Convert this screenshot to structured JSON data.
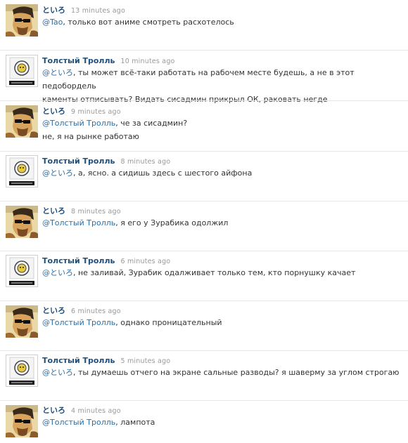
{
  "users": {
    "toiro": {
      "name": "といろ",
      "avatar": "sunglasses-man-avatar"
    },
    "troll": {
      "name": "Толстый Тролль",
      "avatar": "troll-badge-avatar"
    }
  },
  "tweets": [
    {
      "author": "といろ",
      "time": "13 minutes ago",
      "lines": [
        {
          "mention": "@Tao",
          "text": ", только вот аниме смотреть расхотелось"
        }
      ]
    },
    {
      "author": "Толстый Тролль",
      "time": "10 minutes ago",
      "lines": [
        {
          "mention": "@といろ",
          "text": ", ты может всё-таки работать на рабочем месте будешь, а не в этот педобордель"
        },
        {
          "mention": "",
          "text": "каменты отписывать? Видать сисадмин прикрыл ОК, раковать негде"
        }
      ]
    },
    {
      "author": "といろ",
      "time": "9 minutes ago",
      "lines": [
        {
          "mention": "@Толстый Тролль",
          "text": ", че за сисадмин?"
        },
        {
          "mention": "",
          "text": "не, я на рынке работаю"
        }
      ]
    },
    {
      "author": "Толстый Тролль",
      "time": "8 minutes ago",
      "lines": [
        {
          "mention": "@といろ",
          "text": ", а, ясно. а сидишь здесь с шестого айфона"
        }
      ]
    },
    {
      "author": "といろ",
      "time": "8 minutes ago",
      "lines": [
        {
          "mention": "@Толстый Тролль",
          "text": ", я его у Зурабика одолжил"
        }
      ]
    },
    {
      "author": "Толстый Тролль",
      "time": "6 minutes ago",
      "lines": [
        {
          "mention": "@といろ",
          "text": ", не заливай, Зурабик одалживает только тем, кто порнушку качает"
        }
      ]
    },
    {
      "author": "といろ",
      "time": "6 minutes ago",
      "lines": [
        {
          "mention": "@Толстый Тролль",
          "text": ", однако проницательный"
        }
      ]
    },
    {
      "author": "Толстый Тролль",
      "time": "5 minutes ago",
      "lines": [
        {
          "mention": "@といろ",
          "text": ", ты думаешь отчего на экране сальные разводы? я шаверму за углом строгаю"
        }
      ]
    },
    {
      "author": "といろ",
      "time": "4 minutes ago",
      "lines": [
        {
          "mention": "@Толстый Тролль",
          "text": ", лампота"
        }
      ]
    }
  ],
  "colors": {
    "author": "#1f4f7a",
    "mention": "#2a6fa8",
    "time": "#999999",
    "text": "#333333",
    "separator": "#e6e6e6"
  }
}
